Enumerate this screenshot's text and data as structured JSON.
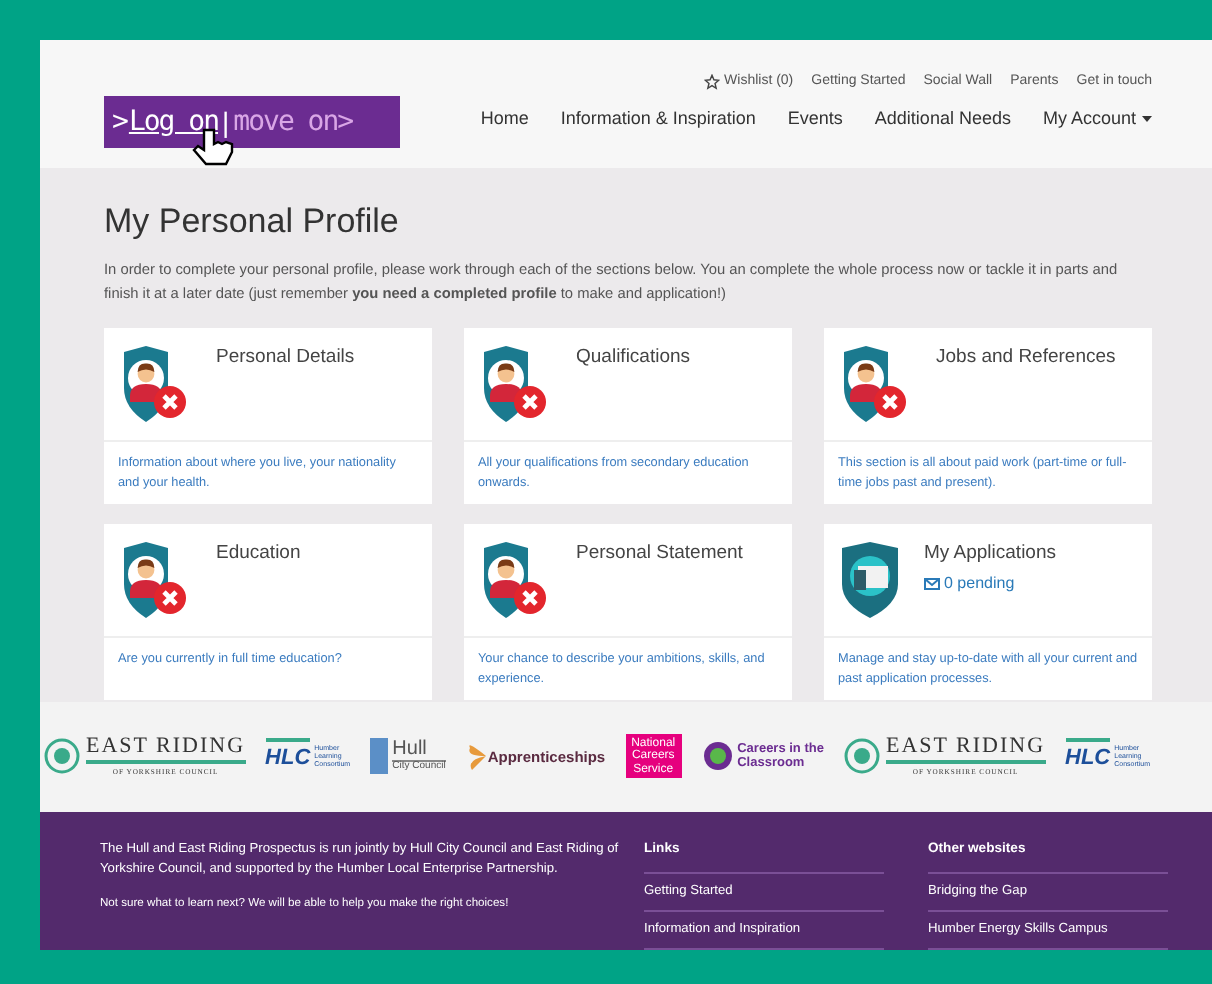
{
  "banner": {
    "prefix": ">",
    "login_link": "Log on",
    "separator": "|",
    "tagline": "move on>"
  },
  "top_links": [
    {
      "label": "Wishlist (0)",
      "kind": "wishlist"
    },
    {
      "label": "Getting Started",
      "kind": "plain"
    },
    {
      "label": "Social Wall",
      "kind": "plain"
    },
    {
      "label": "Parents",
      "kind": "plain"
    },
    {
      "label": "Get in touch",
      "kind": "plain"
    }
  ],
  "main_nav": [
    {
      "label": "Home",
      "dropdown": false
    },
    {
      "label": "Information & Inspiration",
      "dropdown": false
    },
    {
      "label": "Events",
      "dropdown": false
    },
    {
      "label": "Additional Needs",
      "dropdown": false
    },
    {
      "label": "My Account",
      "dropdown": true
    }
  ],
  "page": {
    "title": "My Personal Profile",
    "intro": "In order to complete your personal profile, please work through each of the sections below. You an complete the whole process now or tackle it in parts and finish it at a later date (just remember **you need a completed profile** to make and application!)"
  },
  "sections": [
    {
      "title": "Personal Details",
      "kind": "profile",
      "complete": false,
      "description": "Information about where you live, your nationality and your health."
    },
    {
      "title": "Qualifications",
      "kind": "profile",
      "complete": false,
      "description": "All your qualifications from secondary education onwards."
    },
    {
      "title": "Jobs and References",
      "kind": "profile",
      "complete": false,
      "description": "This section is all about paid work (part-time or full-time jobs past and present)."
    },
    {
      "title": "Education",
      "kind": "profile",
      "complete": false,
      "description": "Are you currently in full time education?"
    },
    {
      "title": "Personal Statement",
      "kind": "profile",
      "complete": false,
      "description": "Your chance to describe your ambitions, skills, and experience."
    },
    {
      "title": "My Applications",
      "kind": "applications",
      "pending": "0 pending",
      "description": "Manage and stay up-to-date with all your current and past application processes."
    }
  ],
  "partners": [
    {
      "kind": "eastriding",
      "name": "EAST RIDING",
      "sub": "OF YORKSHIRE COUNCIL"
    },
    {
      "kind": "hlc",
      "name": "HLC",
      "sub": "Humber Learning Consortium"
    },
    {
      "kind": "hull",
      "name": "Hull",
      "sub": "City Council"
    },
    {
      "kind": "apprenticeships",
      "name": "Apprenticeships"
    },
    {
      "kind": "ncs",
      "name": "National Careers Service"
    },
    {
      "kind": "careers",
      "name": "Careers in the",
      "sub": "Classroom"
    },
    {
      "kind": "eastriding",
      "name": "EAST RIDING",
      "sub": "OF YORKSHIRE COUNCIL"
    },
    {
      "kind": "hlc",
      "name": "HLC",
      "sub": "Humber Learning Consortium"
    }
  ],
  "footer": {
    "about": "The Hull and East Riding Prospectus is run jointly by Hull City Council and East Riding of Yorkshire Council, and supported by the Humber Local Enterprise Partnership.",
    "help": "Not sure what to learn next? We will be able to help you make the right choices!",
    "columns": [
      {
        "heading": "Links",
        "links": [
          "Getting Started",
          "Information and Inspiration"
        ]
      },
      {
        "heading": "Other websites",
        "links": [
          "Bridging the Gap",
          "Humber Energy Skills Campus"
        ]
      }
    ]
  }
}
